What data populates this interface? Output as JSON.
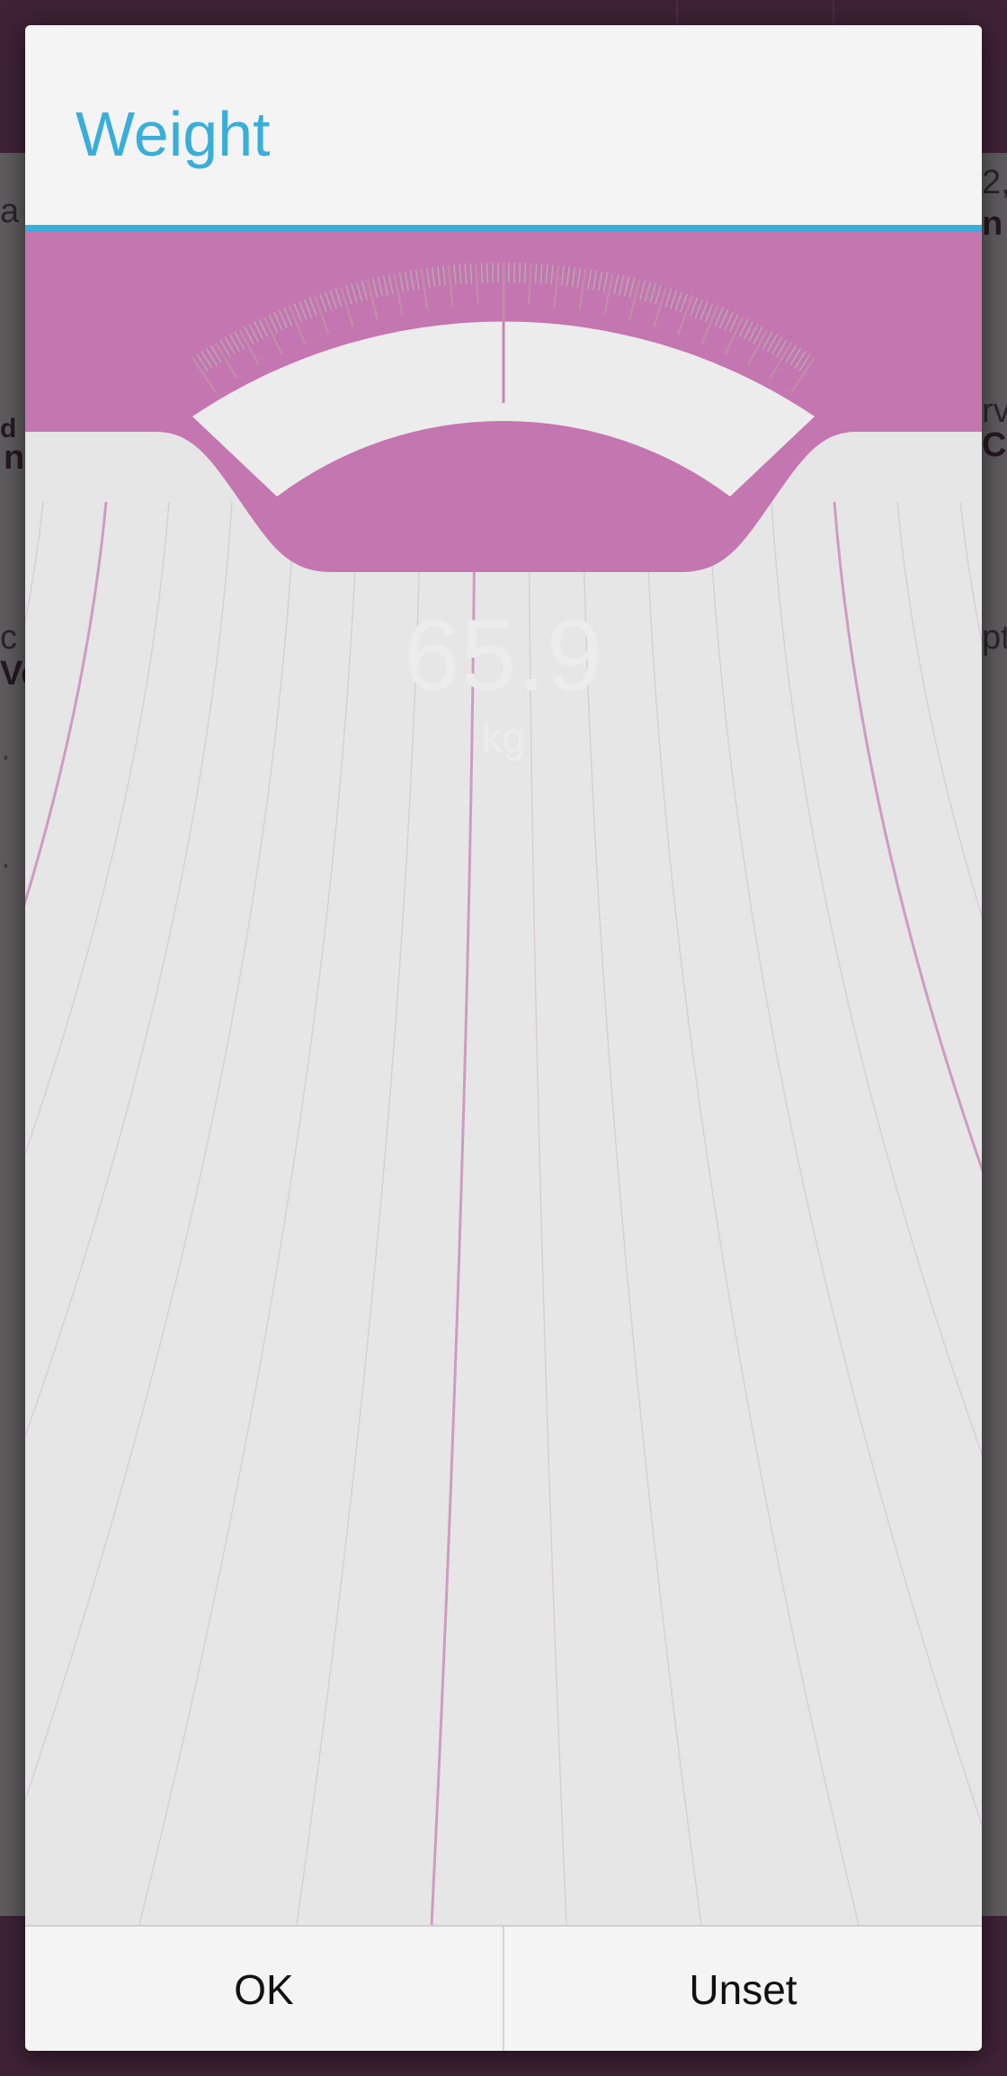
{
  "dialog": {
    "title": "Weight",
    "weight_value": "65.9",
    "weight_unit": "kg",
    "ok_label": "OK",
    "unset_label": "Unset"
  },
  "background": {
    "peek_left": [
      "a",
      "n",
      "d",
      "c",
      "Ve"
    ],
    "peek_right": [
      "2,",
      "n",
      "rv",
      "Cl",
      "pt"
    ]
  },
  "colors": {
    "accent": "#3aaed8",
    "scale_pink": "#c476b0",
    "scale_background": "#e6e6e6",
    "app_bar": "#3f2236"
  }
}
